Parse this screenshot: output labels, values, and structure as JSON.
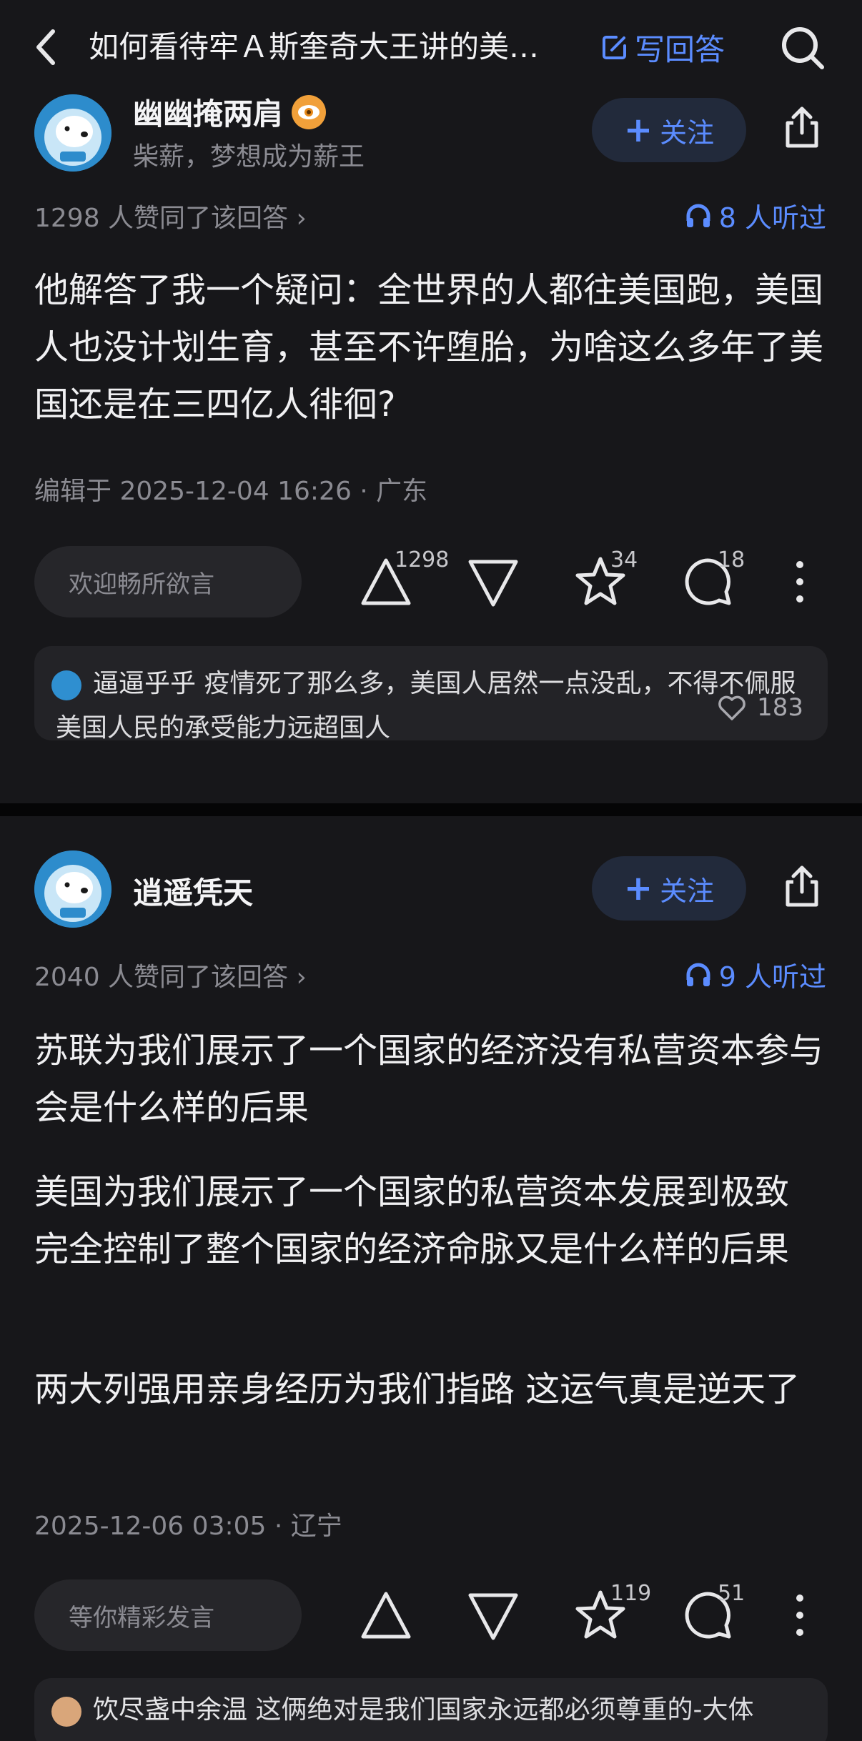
{
  "header": {
    "title": "如何看待牢Ａ斯奎奇大王讲的美…",
    "write_label": "写回答"
  },
  "answers": [
    {
      "author": "幽幽掩两肩",
      "bio": "柴薪，梦想成为薪王",
      "follow_label": "关注",
      "likes_line": "1298 人赞同了该回答 ›",
      "listen_label": "8 人听过",
      "paragraphs": [
        "他解答了我一个疑问：全世界的人都往美国跑，美国人也没计划生育，甚至不许堕胎，为啥这么多年了美国还是在三四亿人徘徊?"
      ],
      "meta": "编辑于 2025-12-04 16:26 · 广东",
      "comment_placeholder": "欢迎畅所欲言",
      "upvote_count": "1298",
      "star_count": "34",
      "comment_count": "18",
      "hot_comment": {
        "user": "逼逼乎乎",
        "text": "疫情死了那么多，美国人居然一点没乱，不得不佩服美国人民的承受能力远超国人",
        "likes": "183"
      }
    },
    {
      "author": "逍遥凭天",
      "follow_label": "关注",
      "likes_line": "2040 人赞同了该回答 ›",
      "listen_label": "9 人听过",
      "paragraphs": [
        "苏联为我们展示了一个国家的经济没有私营资本参与会是什么样的后果",
        "美国为我们展示了一个国家的私营资本发展到极致 完全控制了整个国家的经济命脉又是什么样的后果",
        "两大列强用亲身经历为我们指路 这运气真是逆天了"
      ],
      "meta": "2025-12-06 03:05 · 辽宁",
      "comment_placeholder": "等你精彩发言",
      "star_count": "119",
      "comment_count": "51",
      "hot_comment": {
        "user": "饮尽盏中余温",
        "text": "这俩绝对是我们国家永远都必须尊重的-大体"
      }
    }
  ],
  "icons": {
    "back": "chevron-left-icon",
    "write": "edit-icon",
    "search": "search-icon",
    "share": "share-icon",
    "listen": "headphones-icon",
    "upvote": "triangle-up-icon",
    "downvote": "triangle-down-icon",
    "star": "star-icon",
    "comment": "comment-icon",
    "more": "more-vertical-icon",
    "like": "heart-icon",
    "badge": "eye-badge-icon"
  },
  "colors": {
    "background": "#17171a",
    "accent": "#5b8cff",
    "secondary_text": "#8b8b92"
  }
}
